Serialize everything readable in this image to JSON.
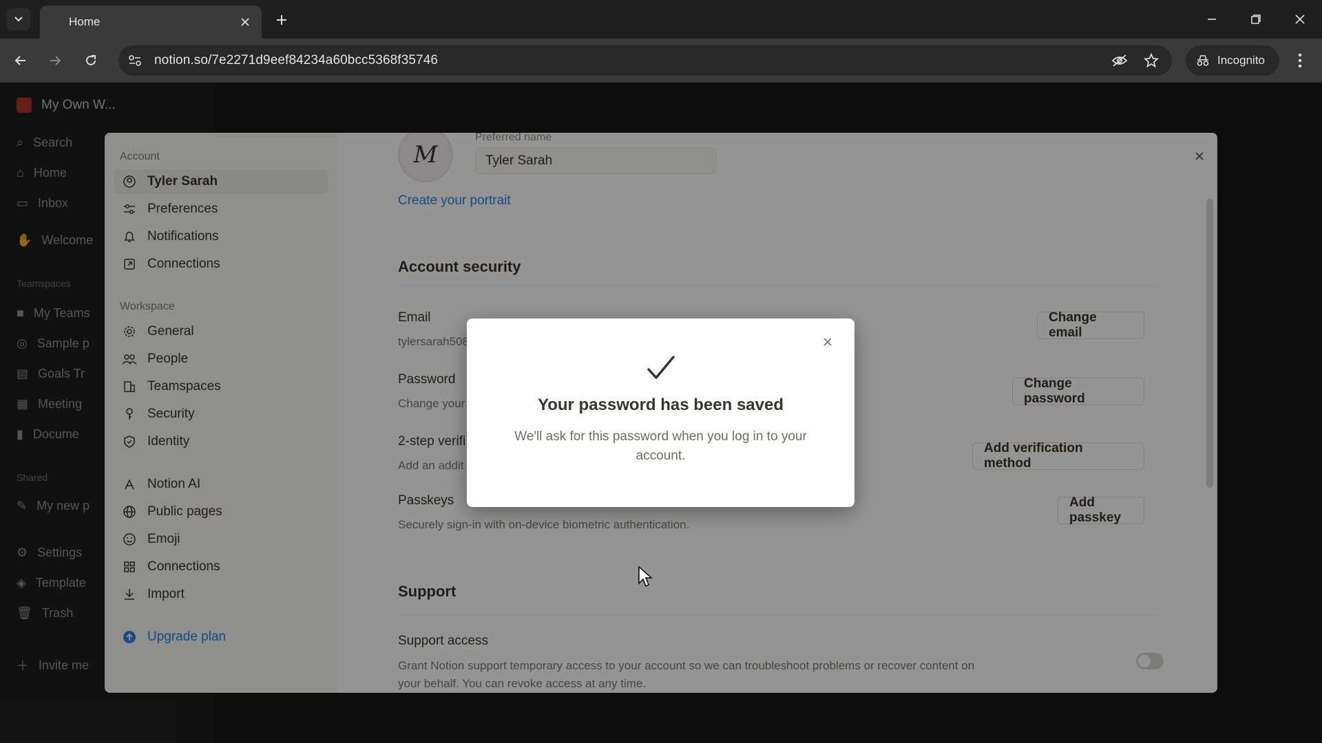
{
  "browser": {
    "tab_title": "Home",
    "url": "notion.so/7e2271d9eef84234a60bcc5368f35746",
    "incognito_label": "Incognito"
  },
  "app_sidebar": {
    "workspace_name": "My Own W...",
    "items": [
      {
        "label": "Search",
        "icon": "search-icon"
      },
      {
        "label": "Home",
        "icon": "home-icon"
      },
      {
        "label": "Inbox",
        "icon": "inbox-icon"
      },
      {
        "label": "Welcome",
        "icon": "wave-icon"
      }
    ],
    "teamspaces_label": "Teamspaces",
    "team_items": [
      {
        "label": "My Teams"
      },
      {
        "label": "Sample p"
      },
      {
        "label": "Goals Tr"
      },
      {
        "label": "Meeting"
      },
      {
        "label": "Docume"
      }
    ],
    "shared_label": "Shared",
    "shared_items": [
      {
        "label": "My new p"
      }
    ],
    "bottom_items": [
      {
        "label": "Settings"
      },
      {
        "label": "Template"
      },
      {
        "label": "Trash"
      },
      {
        "label": "Invite me"
      }
    ]
  },
  "settings": {
    "account_section": "Account",
    "account_items": [
      {
        "label": "Tyler Sarah",
        "icon": "user-avatar-icon"
      },
      {
        "label": "Preferences",
        "icon": "sliders-icon"
      },
      {
        "label": "Notifications",
        "icon": "bell-icon"
      },
      {
        "label": "Connections",
        "icon": "external-link-icon"
      }
    ],
    "workspace_section": "Workspace",
    "workspace_items": [
      {
        "label": "General",
        "icon": "gear-icon"
      },
      {
        "label": "People",
        "icon": "people-icon"
      },
      {
        "label": "Teamspaces",
        "icon": "building-icon"
      },
      {
        "label": "Security",
        "icon": "key-icon"
      },
      {
        "label": "Identity",
        "icon": "shield-check-icon"
      }
    ],
    "extra_items": [
      {
        "label": "Notion AI",
        "icon": "ai-icon"
      },
      {
        "label": "Public pages",
        "icon": "globe-icon"
      },
      {
        "label": "Emoji",
        "icon": "smile-icon"
      },
      {
        "label": "Connections",
        "icon": "grid-icon"
      },
      {
        "label": "Import",
        "icon": "download-icon"
      }
    ],
    "upgrade_label": "Upgrade plan",
    "main": {
      "preferred_name_label": "Preferred name",
      "preferred_name_value": "Tyler Sarah",
      "avatar_letter": "M",
      "create_portrait": "Create your portrait",
      "account_security_heading": "Account security",
      "email_title": "Email",
      "email_value": "tylersarah508",
      "change_email": "Change email",
      "password_title": "Password",
      "password_desc": "Change your",
      "change_password": "Change password",
      "two_step_title": "2-step verifi",
      "two_step_desc": "Add an addit",
      "add_verification": "Add verification method",
      "passkeys_title": "Passkeys",
      "passkeys_desc": "Securely sign-in with on-device biometric authentication.",
      "add_passkey": "Add passkey",
      "support_heading": "Support",
      "support_access_title": "Support access",
      "support_access_desc": "Grant Notion support temporary access to your account so we can troubleshoot problems or recover content on your behalf. You can revoke access at any time.",
      "support_access_enabled": false
    }
  },
  "dialog": {
    "title": "Your password has been saved",
    "body": "We'll ask for this password when you log in to your account."
  }
}
